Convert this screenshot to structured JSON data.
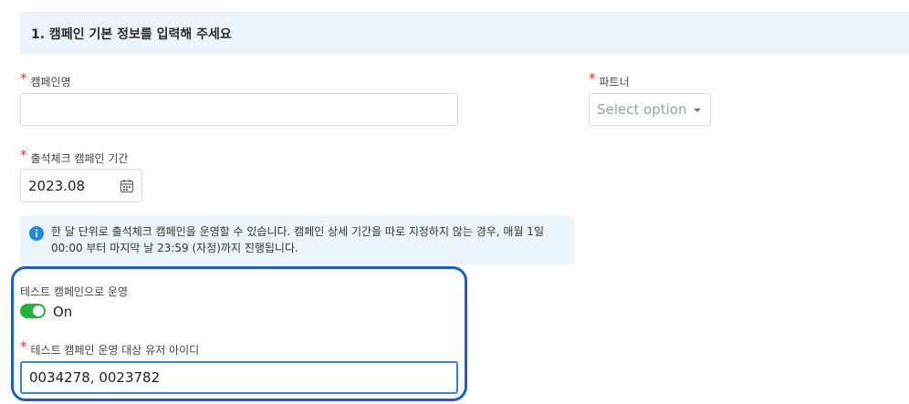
{
  "section": {
    "title": "1. 캠페인 기본 정보를 입력해 주세요"
  },
  "required_mark": "*",
  "campaign_name": {
    "label": "캠페인명",
    "value": ""
  },
  "partner": {
    "label": "파트너",
    "placeholder": "Select option"
  },
  "period": {
    "label": "출석체크 캠페인 기간",
    "value": "2023.08"
  },
  "info": {
    "text": "한 달 단위로 출석체크 캠페인을 운영할 수 있습니다. 캠페인 상세 기간을 따로 지정하지 않는 경우, 매월 1일 00:00 부터 마지막 날 23:59 (자정)까지 진행됩니다."
  },
  "test_mode": {
    "label": "테스트 캠페인으로 운영",
    "state": "On"
  },
  "test_users": {
    "label": "테스트 캠페인 운영 대상 유저 아이디",
    "value": "0034278, 0023782"
  },
  "colors": {
    "accent": "#1b5fcf",
    "toggle_on": "#22b43a",
    "required": "#e5333b",
    "info_bg": "#ecf4fb"
  },
  "icons": {
    "info": "info-circle-icon",
    "calendar": "calendar-icon",
    "dropdown": "chevron-down-icon"
  }
}
